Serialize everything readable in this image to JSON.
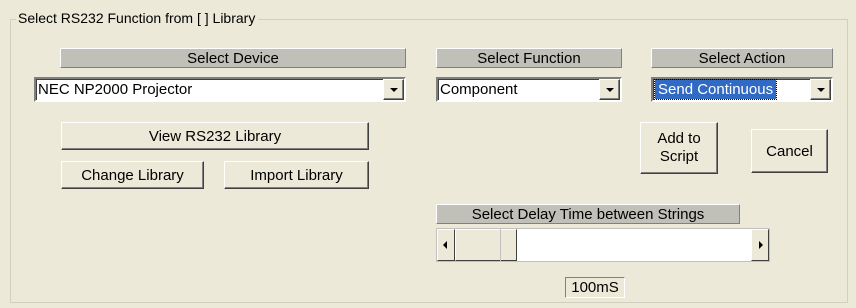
{
  "group": {
    "title": "Select RS232 Function from [ ] Library"
  },
  "device": {
    "header": "Select Device",
    "selected": "NEC NP2000   Projector"
  },
  "function": {
    "header": "Select Function",
    "selected": "Component"
  },
  "action": {
    "header": "Select Action",
    "selected": "Send Continuous"
  },
  "buttons": {
    "view_library": "View RS232 Library",
    "change_library": "Change Library",
    "import_library": "Import Library",
    "add_to_script_line1": "Add to",
    "add_to_script_line2": "Script",
    "cancel": "Cancel"
  },
  "delay": {
    "header": "Select Delay Time between Strings",
    "value": "100mS",
    "slider_fraction": 0.0
  },
  "colors": {
    "background": "#ece9d8",
    "selection": "#316ac5",
    "header_bg": "#c0c0b8"
  }
}
